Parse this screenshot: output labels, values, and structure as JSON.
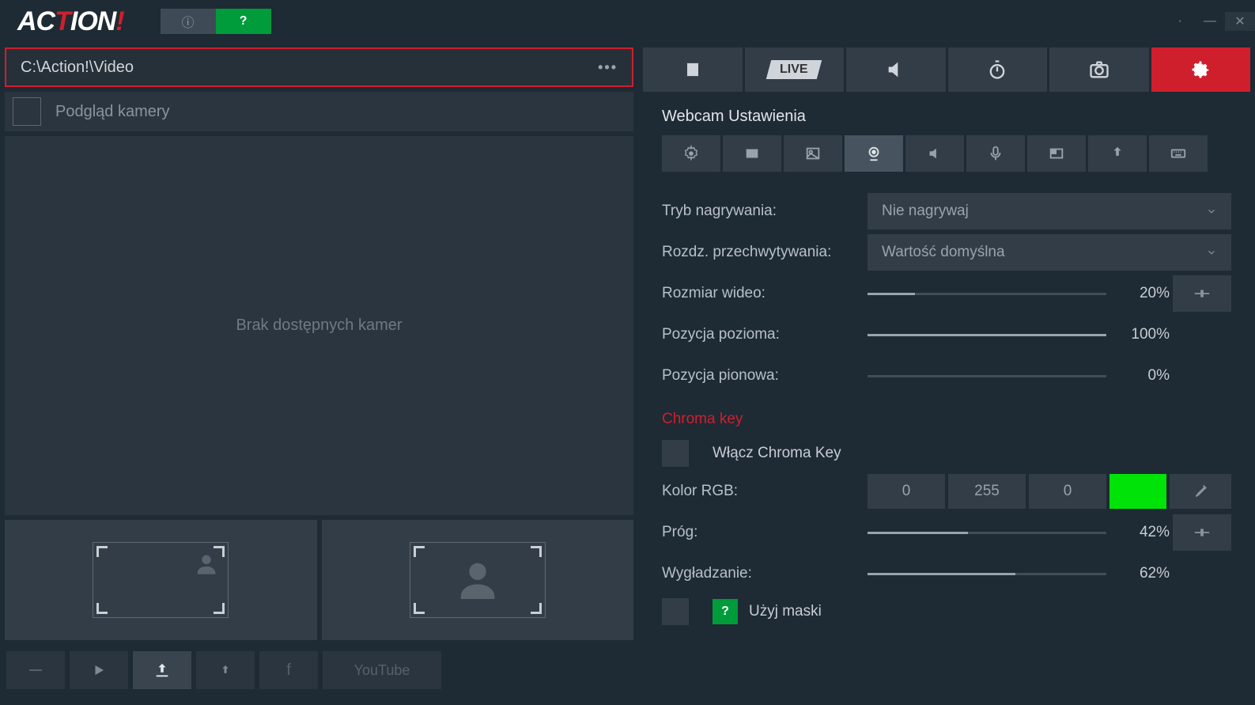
{
  "window": {
    "path": "C:\\Action!\\Video"
  },
  "preview": {
    "checkbox_label": "Podgląd kamery",
    "empty_msg": "Brak dostępnych kamer"
  },
  "section_title": "Webcam Ustawienia",
  "mode_live_label": "LIVE",
  "settings": {
    "recording_mode": {
      "label": "Tryb nagrywania:",
      "value": "Nie nagrywaj"
    },
    "capture_res": {
      "label": "Rozdz. przechwytywania:",
      "value": "Wartość domyślna"
    },
    "video_size": {
      "label": "Rozmiar wideo:",
      "value": "20%",
      "pct": 20
    },
    "pos_h": {
      "label": "Pozycja pozioma:",
      "value": "100%",
      "pct": 100
    },
    "pos_v": {
      "label": "Pozycja pionowa:",
      "value": "0%",
      "pct": 0
    }
  },
  "chroma": {
    "title": "Chroma key",
    "enable_label": "Włącz Chroma Key",
    "rgb_label": "Kolor RGB:",
    "r": "0",
    "g": "255",
    "b": "0",
    "swatch": "#00e308",
    "threshold": {
      "label": "Próg:",
      "value": "42%",
      "pct": 42
    },
    "smooth": {
      "label": "Wygładzanie:",
      "value": "62%",
      "pct": 62
    },
    "mask_label": "Użyj maski"
  },
  "bottom": {
    "youtube": "YouTube"
  }
}
